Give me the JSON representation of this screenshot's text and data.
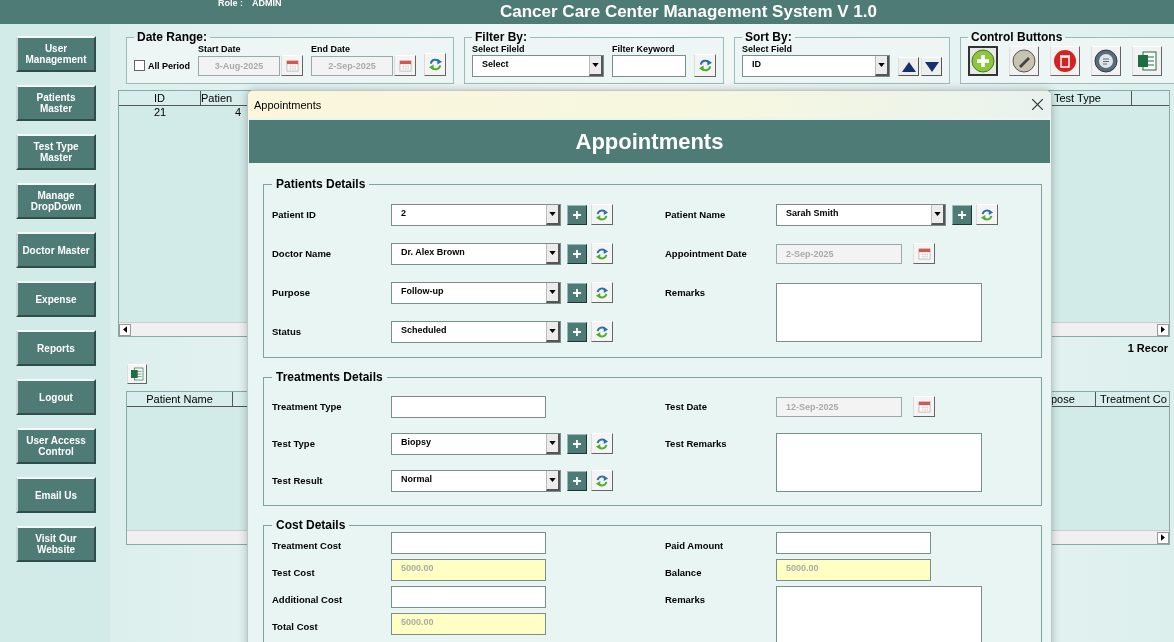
{
  "header": {
    "title": "Cancer Care Center Management System V 1.0",
    "role_label": "Role :",
    "role": "ADMIN"
  },
  "sidebar": {
    "items": [
      "User Management",
      "Patients Master",
      "Test Type Master",
      "Manage DropDown",
      "Doctor Master",
      "Expense",
      "Reports",
      "Logout",
      "User Access Control",
      "Email Us",
      "Visit Our Website"
    ]
  },
  "date_range": {
    "title": "Date Range:",
    "all_period": {
      "label": "All Period",
      "checked": false
    },
    "start_date": {
      "label": "Start Date",
      "value": "3-Aug-2025"
    },
    "end_date": {
      "label": "End Date",
      "value": "2-Sep-2025"
    }
  },
  "filter_by": {
    "title": "Filter By:",
    "field_label": "Select Fileld",
    "field_value": "Select",
    "keyword_label": "Filter Keyword"
  },
  "sort_by": {
    "title": "Sort By:",
    "field_label": "Select Field",
    "field_value": "ID"
  },
  "control_buttons": {
    "title": "Control Buttons"
  },
  "records_table": {
    "columns": [
      "ID",
      "Patien",
      "Test Type"
    ],
    "rows": [
      [
        "21",
        "4"
      ]
    ]
  },
  "record_count": "1 Recor",
  "details_table": {
    "columns": [
      "Patient Name",
      "pose",
      "Treatment Co"
    ]
  },
  "dialog": {
    "title": "Appointments",
    "heading": "Appointments",
    "sections": [
      {
        "title": "Patients Details",
        "rows": [
          [
            {
              "kind": "combo",
              "label": "Patient ID",
              "value": "2"
            },
            {
              "kind": "combo",
              "label": "Patient Name",
              "value": "Sarah Smith"
            }
          ],
          [
            {
              "kind": "combo",
              "label": "Doctor Name",
              "value": "Dr. Alex Brown"
            },
            {
              "kind": "date",
              "label": "Appointment Date",
              "value": "2-Sep-2025"
            }
          ],
          [
            {
              "kind": "combo",
              "label": "Purpose",
              "value": "Follow-up"
            },
            {
              "kind": "textarea",
              "label": "Remarks"
            }
          ],
          [
            {
              "kind": "combo",
              "label": "Status",
              "value": "Scheduled"
            }
          ]
        ]
      },
      {
        "title": "Treatments Details",
        "rows": [
          [
            {
              "kind": "text",
              "label": "Treatment Type"
            },
            {
              "kind": "date",
              "label": "Test Date",
              "value": "12-Sep-2025"
            }
          ],
          [
            {
              "kind": "combo",
              "label": "Test Type",
              "value": "Biopsy"
            },
            {
              "kind": "textarea",
              "label": "Test Remarks"
            }
          ],
          [
            {
              "kind": "combo",
              "label": "Test Result",
              "value": "Normal"
            }
          ]
        ]
      },
      {
        "title": "Cost Details",
        "rows": [
          [
            {
              "kind": "text",
              "label": "Treatment Cost"
            },
            {
              "kind": "text",
              "label": "Paid Amount"
            }
          ],
          [
            {
              "kind": "readonly",
              "label": "Test Cost",
              "value": "5000.00"
            },
            {
              "kind": "readonly",
              "label": "Balance",
              "value": "5000.00"
            }
          ],
          [
            {
              "kind": "text",
              "label": "Additional Cost"
            },
            {
              "kind": "textarea",
              "label": "Remarks"
            }
          ],
          [
            {
              "kind": "readonly",
              "label": "Total Cost",
              "value": "5000.00"
            }
          ]
        ]
      }
    ]
  }
}
